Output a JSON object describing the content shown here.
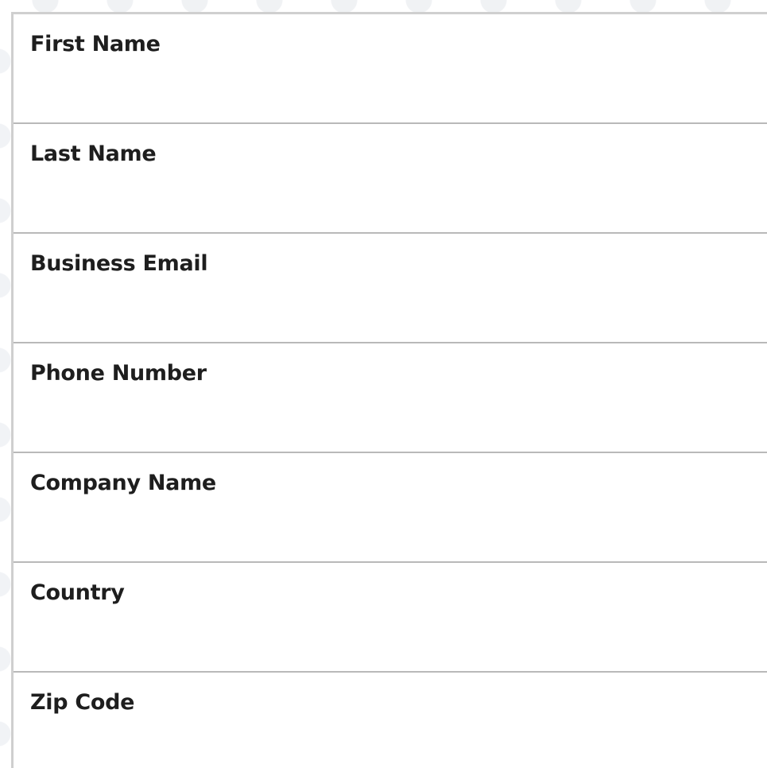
{
  "form": {
    "fields": [
      {
        "id": "first-name",
        "label": "First Name",
        "value": ""
      },
      {
        "id": "last-name",
        "label": "Last Name",
        "value": ""
      },
      {
        "id": "business-email",
        "label": "Business Email",
        "value": ""
      },
      {
        "id": "phone-number",
        "label": "Phone Number",
        "value": ""
      },
      {
        "id": "company-name",
        "label": "Company Name",
        "value": ""
      },
      {
        "id": "country",
        "label": "Country",
        "value": "",
        "type": "select",
        "icon": "select-arrows-icon"
      },
      {
        "id": "zip-code",
        "label": "Zip Code",
        "value": ""
      }
    ]
  },
  "colors": {
    "label_text": "#1e1e1e",
    "divider": "#b9b9b9",
    "border": "#cfcfcf",
    "background": "#ffffff"
  }
}
